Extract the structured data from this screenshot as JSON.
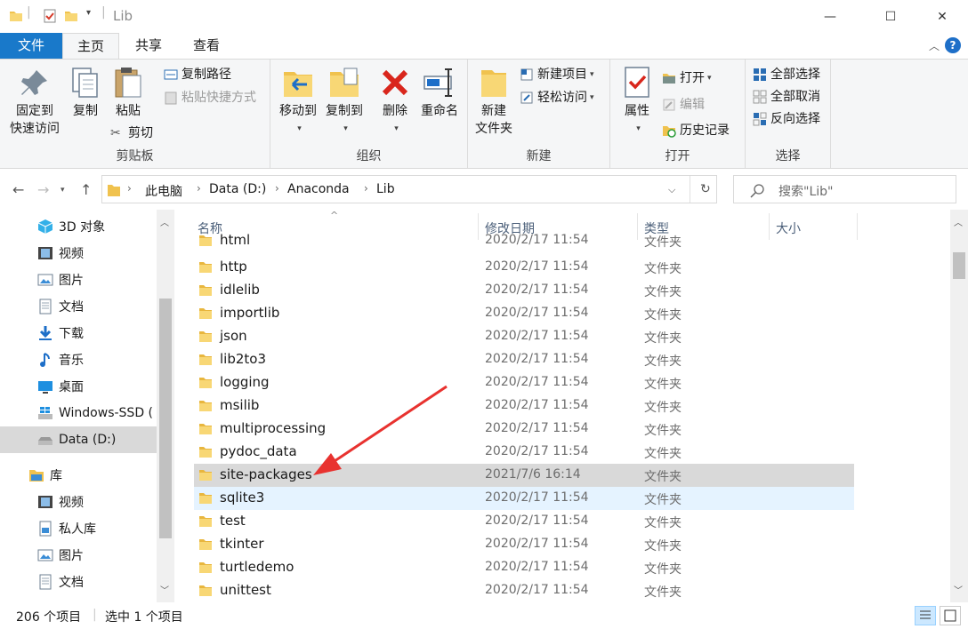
{
  "window": {
    "title": "Lib",
    "minimize": "—",
    "maximize": "☐",
    "close": "✕"
  },
  "tabs": [
    {
      "label": "文件"
    },
    {
      "label": "主页"
    },
    {
      "label": "共享"
    },
    {
      "label": "查看"
    }
  ],
  "ribbon": {
    "clipboard": {
      "label": "剪贴板",
      "pin": "固定到\n快速访问",
      "pin_line1": "固定到",
      "pin_line2": "快速访问",
      "copy": "复制",
      "paste": "粘贴",
      "copy_path": "复制路径",
      "paste_shortcut": "粘贴快捷方式",
      "cut": "剪切"
    },
    "organize": {
      "label": "组织",
      "move_to": "移动到",
      "copy_to": "复制到",
      "delete": "删除",
      "rename": "重命名"
    },
    "new": {
      "label": "新建",
      "new_folder_line1": "新建",
      "new_folder_line2": "文件夹",
      "new_item": "新建项目",
      "easy_access": "轻松访问"
    },
    "open": {
      "label": "打开",
      "properties": "属性",
      "open": "打开",
      "edit": "编辑",
      "history": "历史记录"
    },
    "select": {
      "label": "选择",
      "select_all": "全部选择",
      "select_none": "全部取消",
      "invert": "反向选择"
    }
  },
  "address": {
    "crumbs": [
      "此电脑",
      "Data (D:)",
      "Anaconda",
      "Lib"
    ],
    "search_placeholder": "搜索\"Lib\""
  },
  "navpane": {
    "items": [
      {
        "label": "3D 对象",
        "icon": "3d-objects-icon"
      },
      {
        "label": "视频",
        "icon": "video-icon"
      },
      {
        "label": "图片",
        "icon": "pictures-icon"
      },
      {
        "label": "文档",
        "icon": "documents-icon"
      },
      {
        "label": "下载",
        "icon": "download-icon"
      },
      {
        "label": "音乐",
        "icon": "music-icon"
      },
      {
        "label": "桌面",
        "icon": "desktop-icon"
      },
      {
        "label": "Windows-SSD (",
        "icon": "windows-drive-icon"
      },
      {
        "label": "Data (D:)",
        "icon": "drive-icon"
      },
      {
        "label": "库",
        "icon": "library-icon"
      },
      {
        "label": "视频",
        "icon": "video-icon"
      },
      {
        "label": "私人库",
        "icon": "private-library-icon"
      },
      {
        "label": "图片",
        "icon": "pictures-icon"
      },
      {
        "label": "文档",
        "icon": "documents-icon"
      }
    ]
  },
  "filelist": {
    "columns": {
      "name": "名称",
      "date": "修改日期",
      "type": "类型",
      "size": "大小"
    },
    "rows": [
      {
        "name": "html",
        "date": "2020/2/17 11:54",
        "type": "文件夹"
      },
      {
        "name": "http",
        "date": "2020/2/17 11:54",
        "type": "文件夹"
      },
      {
        "name": "idlelib",
        "date": "2020/2/17 11:54",
        "type": "文件夹"
      },
      {
        "name": "importlib",
        "date": "2020/2/17 11:54",
        "type": "文件夹"
      },
      {
        "name": "json",
        "date": "2020/2/17 11:54",
        "type": "文件夹"
      },
      {
        "name": "lib2to3",
        "date": "2020/2/17 11:54",
        "type": "文件夹"
      },
      {
        "name": "logging",
        "date": "2020/2/17 11:54",
        "type": "文件夹"
      },
      {
        "name": "msilib",
        "date": "2020/2/17 11:54",
        "type": "文件夹"
      },
      {
        "name": "multiprocessing",
        "date": "2020/2/17 11:54",
        "type": "文件夹"
      },
      {
        "name": "pydoc_data",
        "date": "2020/2/17 11:54",
        "type": "文件夹"
      },
      {
        "name": "site-packages",
        "date": "2021/7/6 16:14",
        "type": "文件夹"
      },
      {
        "name": "sqlite3",
        "date": "2020/2/17 11:54",
        "type": "文件夹"
      },
      {
        "name": "test",
        "date": "2020/2/17 11:54",
        "type": "文件夹"
      },
      {
        "name": "tkinter",
        "date": "2020/2/17 11:54",
        "type": "文件夹"
      },
      {
        "name": "turtledemo",
        "date": "2020/2/17 11:54",
        "type": "文件夹"
      },
      {
        "name": "unittest",
        "date": "2020/2/17 11:54",
        "type": "文件夹"
      }
    ]
  },
  "status": {
    "count": "206 个项目",
    "selected": "选中 1 个项目"
  },
  "colors": {
    "accent": "#1979ca",
    "folder": "#f0c24e",
    "annotation_arrow": "#e8322f",
    "selected_row": "#d9d9d9",
    "hover_row": "#e5f3ff"
  }
}
